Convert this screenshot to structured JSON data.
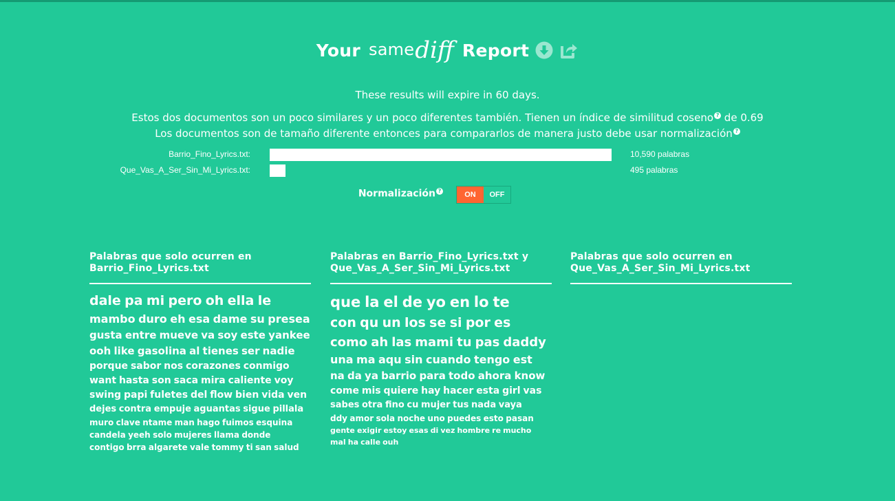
{
  "header": {
    "your": "Your",
    "logo_same": "same",
    "logo_diff": "diff",
    "report": "Report",
    "icons": [
      "download-icon",
      "share-icon"
    ]
  },
  "expire_text": "These results will expire in 60 days.",
  "summary": {
    "line1": "Estos dos documentos son un poco similares y un poco diferentes también. Tienen un índice de similitud coseno",
    "line1_suffix": " de 0.69",
    "line2": "Los documentos son de tamaño diferente entonces para compararlos de manera justo debe usar normalización"
  },
  "help_glyph": "?",
  "documents": [
    {
      "name": "Barrio_Fino_Lyrics.txt:",
      "count": "10,590 palabras",
      "relative_size": 1.0
    },
    {
      "name": "Que_Vas_A_Ser_Sin_Mi_Lyrics.txt:",
      "count": "495 palabras",
      "relative_size": 0.047
    }
  ],
  "normalization": {
    "label": "Normalización",
    "on": "ON",
    "off": "OFF",
    "selected": "ON"
  },
  "colors": {
    "background": "#21c998",
    "accent": "#ff6532",
    "text": "#ffffff",
    "top_border": "#159a73"
  },
  "columns": [
    {
      "title_line1": "Palabras que solo ocurren en",
      "title_line2": "Barrio_Fino_Lyrics.txt",
      "lines": [
        {
          "size": 19,
          "words": [
            "dale",
            "pa",
            "mi",
            "pero",
            "oh",
            "ella",
            "le"
          ]
        },
        {
          "size": 16,
          "words": [
            "mambo",
            "duro",
            "eh",
            "esa",
            "dame",
            "su",
            "presea"
          ]
        },
        {
          "size": 15,
          "words": [
            "gusta",
            "entre",
            "mueve",
            "va",
            "soy",
            "este",
            "yankee"
          ]
        },
        {
          "size": 15,
          "words": [
            "ooh",
            "like",
            "gasolina",
            "al",
            "tienes",
            "ser",
            "nadie"
          ]
        },
        {
          "size": 14,
          "words": [
            "porque",
            "sabor",
            "nos",
            "corazones",
            "conmigo"
          ]
        },
        {
          "size": 14,
          "words": [
            "want",
            "hasta",
            "son",
            "saca",
            "mira",
            "caliente",
            "voy"
          ]
        },
        {
          "size": 14,
          "words": [
            "swing",
            "papi",
            "fuletes",
            "del",
            "flow",
            "bien",
            "vida",
            "ven"
          ]
        },
        {
          "size": 13,
          "words": [
            "dejes",
            "contra",
            "empuje",
            "aguantas",
            "sigue",
            "pillala"
          ]
        },
        {
          "size": 12,
          "words": [
            "muro",
            "clave",
            "ntame",
            "man",
            "hago",
            "fuimos",
            "esquina"
          ]
        },
        {
          "size": 12,
          "words": [
            "candela",
            "yeeh",
            "solo",
            "mujeres",
            "llama",
            "donde"
          ]
        },
        {
          "size": 12,
          "words": [
            "contigo",
            "brra",
            "algarete",
            "vale",
            "tommy",
            "ti",
            "san",
            "salud"
          ]
        }
      ]
    },
    {
      "title_line1": "Palabras en Barrio_Fino_Lyrics.txt y",
      "title_line2": "Que_Vas_A_Ser_Sin_Mi_Lyrics.txt",
      "lines": [
        {
          "size": 21,
          "words": [
            "que",
            "la",
            "el",
            "de",
            "yo",
            "en",
            "lo",
            "te"
          ]
        },
        {
          "size": 19,
          "words": [
            "con",
            "qu",
            "un",
            "los",
            "se",
            "si",
            "por",
            "es"
          ]
        },
        {
          "size": 18,
          "words": [
            "como",
            "ah",
            "las",
            "mami",
            "tu",
            "pas",
            "daddy"
          ]
        },
        {
          "size": 16,
          "words": [
            "una",
            "ma",
            "aqu",
            "sin",
            "cuando",
            "tengo",
            "est"
          ]
        },
        {
          "size": 15,
          "words": [
            "na",
            "da",
            "ya",
            "barrio",
            "para",
            "todo",
            "ahora",
            "know"
          ]
        },
        {
          "size": 14,
          "words": [
            "come",
            "mis",
            "quiere",
            "hay",
            "hacer",
            "esta",
            "girl",
            "vas"
          ]
        },
        {
          "size": 13,
          "words": [
            "sabes",
            "otra",
            "fino",
            "cu",
            "mujer",
            "tus",
            "nada",
            "vaya"
          ]
        },
        {
          "size": 12,
          "words": [
            "ddy",
            "amor",
            "sola",
            "noche",
            "uno",
            "puedes",
            "esto",
            "pasan"
          ]
        },
        {
          "size": 11,
          "words": [
            "gente",
            "exigir",
            "estoy",
            "esas",
            "di",
            "vez",
            "hombre",
            "re",
            "mucho"
          ]
        },
        {
          "size": 11,
          "words": [
            "mal",
            "ha",
            "calle",
            "ouh"
          ]
        }
      ]
    },
    {
      "title_line1": "Palabras que solo ocurren en",
      "title_line2": "Que_Vas_A_Ser_Sin_Mi_Lyrics.txt",
      "lines": []
    }
  ]
}
